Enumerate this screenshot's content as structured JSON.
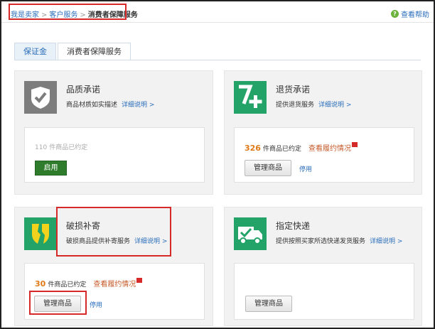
{
  "breadcrumb": {
    "items": [
      "我是卖家",
      "客户服务"
    ],
    "current": "消费者保障服务",
    "separator": ">"
  },
  "help": {
    "icon": "question-circle-icon",
    "label": "查看帮助"
  },
  "tabs": [
    {
      "label": "保证金",
      "active": false
    },
    {
      "label": "消费者保障服务",
      "active": true
    }
  ],
  "services": [
    {
      "icon": "shield-check-icon",
      "title": "品质承诺",
      "desc": "商品材质如实描述",
      "more": "详细说明 >",
      "count_value": "110",
      "count_suffix": "件商品已约定",
      "button": "启用"
    },
    {
      "icon": "seven-plus-icon",
      "title": "退货承诺",
      "desc": "提供退货服务",
      "more": "详细说明 >",
      "count_value": "326",
      "count_suffix": "件商品已约定",
      "view_link": "查看履约情况",
      "button": "管理商品",
      "stop": "停用"
    },
    {
      "icon": "broken-shield-icon",
      "title": "破损补寄",
      "desc": "破损商品提供补寄服务",
      "more": "详细说明 >",
      "count_value": "30",
      "count_suffix": "件商品已约定",
      "view_link": "查看履约情况",
      "button": "管理商品",
      "stop": "停用"
    },
    {
      "icon": "delivery-truck-icon",
      "title": "指定快递",
      "desc": "提供按照买家所选快递发货服务",
      "more": "详细说明 >",
      "button": "管理商品"
    }
  ],
  "colors": {
    "accent_blue": "#2a6ebb",
    "green": "#23a368",
    "highlight_red": "#d62a2a",
    "orange": "#e07a18"
  }
}
